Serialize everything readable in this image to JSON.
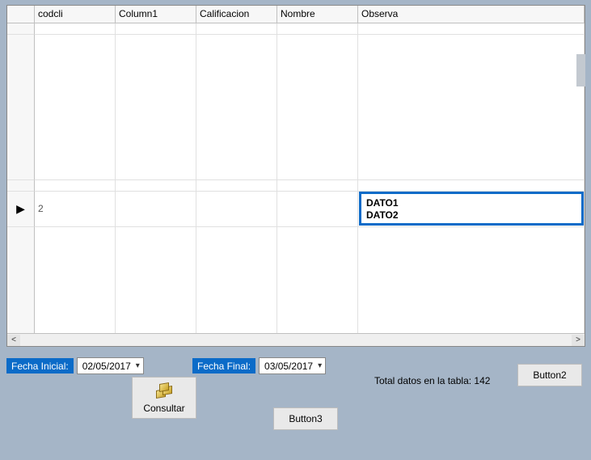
{
  "grid": {
    "headers": {
      "codcli": "codcli",
      "column1": "Column1",
      "calificacion": "Calificacion",
      "nombre": "Nombre",
      "observa": "Observa"
    },
    "top_peek": {
      "column1": "",
      "calificacion": "",
      "nombre": ""
    },
    "mid_peek": {
      "calificacion": ""
    },
    "current_row": {
      "indicator": "▶",
      "codcli": "2",
      "observa_line1": "DATO1",
      "observa_line2": "DATO2"
    }
  },
  "filters": {
    "fecha_inicial_label": "Fecha Inicial:",
    "fecha_inicial_value": "02/05/2017",
    "fecha_final_label": "Fecha Final:",
    "fecha_final_value": "03/05/2017"
  },
  "status": {
    "total_label": "Total datos en la tabla: 142"
  },
  "buttons": {
    "consultar": "Consultar",
    "button2": "Button2",
    "button3": "Button3"
  }
}
